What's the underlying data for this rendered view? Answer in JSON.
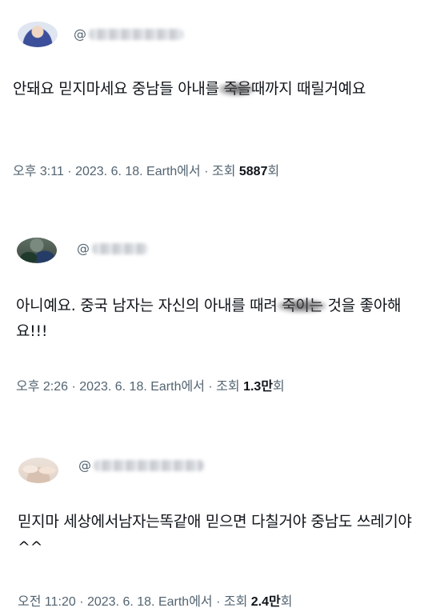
{
  "tweets": [
    {
      "handle_prefix": "@",
      "text_before": "안돼요 믿지마세요 중남들 아내를 ",
      "text_censored": "죽을",
      "text_after": "때까지 때릴거예요",
      "time": "오후 3:11",
      "date": "2023. 6. 18.",
      "source": "Earth에서",
      "views_label": "조회",
      "views_number": "5887",
      "views_unit": "",
      "views_suffix": "회"
    },
    {
      "handle_prefix": "@",
      "text_before": "아니예요. 중국 남자는 자신의 아내를 때려 ",
      "text_censored": "죽이는",
      "text_after": " 것을 좋아해요!!!",
      "time": "오후 2:26",
      "date": "2023. 6. 18.",
      "source": "Earth에서",
      "views_label": "조회",
      "views_number": "1.3",
      "views_unit": "만",
      "views_suffix": "회"
    },
    {
      "handle_prefix": "@",
      "text_before": "믿지마 세상에서남자는똑같애 믿으면 다칠거야 중남도 쓰레기야^^",
      "text_censored": "",
      "text_after": "",
      "time": "오전 11:20",
      "date": "2023. 6. 18.",
      "source": "Earth에서",
      "views_label": "조회",
      "views_number": "2.4",
      "views_unit": "만",
      "views_suffix": "회"
    }
  ],
  "separator": "·",
  "colors": {
    "text": "#0f1419",
    "meta": "#536471",
    "background": "#ffffff"
  }
}
